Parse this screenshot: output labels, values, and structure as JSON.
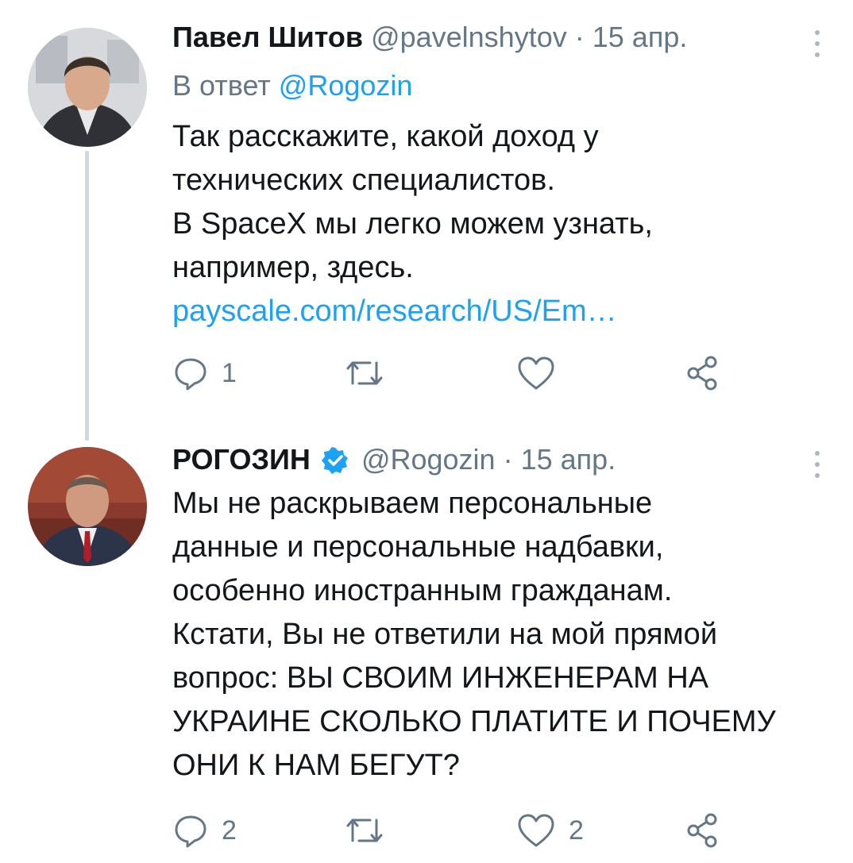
{
  "tweets": [
    {
      "display_name": "Павел Шитов",
      "handle": "@pavelnshytov",
      "date": "15 апр.",
      "reply_to_prefix": "В ответ",
      "reply_to_handle": "@Rogozin",
      "lines": [
        "Так расскажите, какой доход у",
        "технических специалистов.",
        "В SpaceX мы легко можем узнать,",
        "например, здесь."
      ],
      "link": "payscale.com/research/US/Em…",
      "reply_count": "1",
      "retweet_count": "",
      "like_count": ""
    },
    {
      "display_name": "РОГОЗИН",
      "verified": true,
      "handle": "@Rogozin",
      "date": "15 апр.",
      "lines": [
        "Мы не раскрываем персональные",
        "данные и персональные надбавки,",
        "особенно иностранным гражданам.",
        "Кстати, Вы не ответили на мой прямой",
        "вопрос: ВЫ СВОИМ ИНЖЕНЕРАМ НА",
        "УКРАИНЕ СКОЛЬКО ПЛАТИТЕ И ПОЧЕМУ",
        "ОНИ К НАМ БЕГУТ?"
      ],
      "reply_count": "2",
      "retweet_count": "",
      "like_count": "2"
    }
  ],
  "icons": {
    "reply": "reply-icon",
    "retweet": "retweet-icon",
    "like": "heart-icon",
    "share": "share-icon",
    "more": "more-vertical-icon",
    "verified": "verified-badge-icon"
  },
  "colors": {
    "text": "#14171a",
    "secondary": "#657786",
    "link": "#1da1f2",
    "verified": "#1da1f2",
    "thread_line": "#cfd9de"
  }
}
